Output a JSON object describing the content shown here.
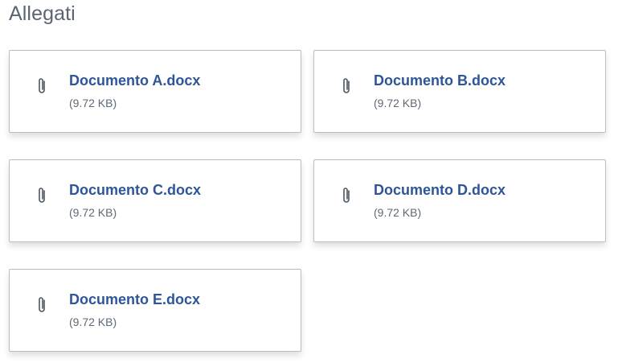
{
  "section": {
    "title": "Allegati"
  },
  "attachments": [
    {
      "name": "Documento A.docx",
      "size": "(9.72 KB)"
    },
    {
      "name": "Documento B.docx",
      "size": "(9.72 KB)"
    },
    {
      "name": "Documento C.docx",
      "size": "(9.72 KB)"
    },
    {
      "name": "Documento D.docx",
      "size": "(9.72 KB)"
    },
    {
      "name": "Documento E.docx",
      "size": "(9.72 KB)"
    }
  ],
  "icons": {
    "attachment": "paperclip-icon"
  },
  "colors": {
    "title": "#5b6470",
    "link": "#2d5597",
    "meta": "#5f6a76",
    "icon": "#4b5560",
    "border": "#b9bec4"
  }
}
